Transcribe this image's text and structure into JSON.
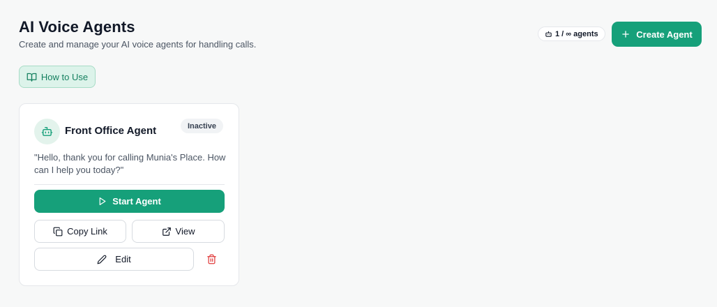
{
  "header": {
    "title": "AI Voice Agents",
    "subtitle": "Create and manage your AI voice agents for handling calls.",
    "agent_count": "1 / ∞ agents",
    "create_label": "Create Agent",
    "count_icon": "robot-icon",
    "create_icon": "plus-icon"
  },
  "how_to_use": {
    "label": "How to Use",
    "icon": "book-open-icon"
  },
  "agent_card": {
    "name": "Front Office Agent",
    "status": "Inactive",
    "greeting": "\"Hello, thank you for calling Munia's Place. How can I help you today?\"",
    "avatar_icon": "bot-icon",
    "start_label": "Start Agent",
    "start_icon": "play-icon",
    "copy_label": "Copy Link",
    "copy_icon": "copy-icon",
    "view_label": "View",
    "view_icon": "external-link-icon",
    "edit_label": "Edit",
    "edit_icon": "pencil-icon",
    "delete_icon": "trash-icon"
  },
  "colors": {
    "primary": "#16a07a",
    "primary_light": "#dcf3ea",
    "danger": "#e03b3b",
    "background": "#f7f8f8"
  }
}
